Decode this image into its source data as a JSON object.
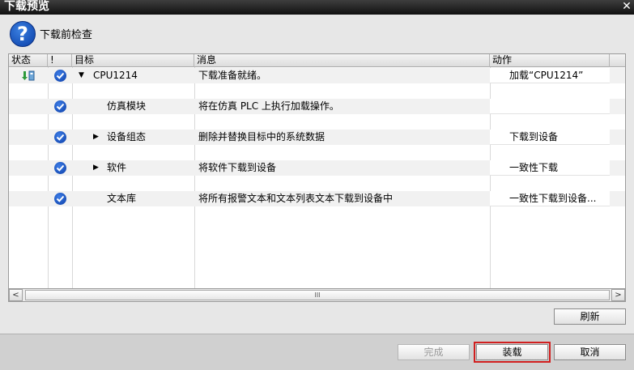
{
  "window": {
    "title": "下载预览",
    "close_glyph": "✕"
  },
  "header": {
    "text": "下载前检查"
  },
  "table": {
    "columns": [
      "状态",
      "!",
      "目标",
      "消息",
      "动作"
    ],
    "rows": [
      {
        "status_icon": "download-icon",
        "checked": true,
        "expander": "▼",
        "target": "CPU1214",
        "message": "下载准备就绪。",
        "action": "加载“CPU1214”"
      },
      {
        "checked": false,
        "expander": "",
        "target": "",
        "message": "",
        "action": ""
      },
      {
        "checked": true,
        "expander": "",
        "target": "仿真模块",
        "message": "将在仿真 PLC 上执行加载操作。",
        "action": ""
      },
      {
        "checked": false,
        "expander": "",
        "target": "",
        "message": "",
        "action": ""
      },
      {
        "checked": true,
        "expander": "▶",
        "target": "设备组态",
        "message": "删除并替换目标中的系统数据",
        "action": "下载到设备"
      },
      {
        "checked": false,
        "expander": "",
        "target": "",
        "message": "",
        "action": ""
      },
      {
        "checked": true,
        "expander": "▶",
        "target": "软件",
        "message": "将软件下载到设备",
        "action": "一致性下载"
      },
      {
        "checked": false,
        "expander": "",
        "target": "",
        "message": "",
        "action": ""
      },
      {
        "checked": true,
        "expander": "",
        "target": "文本库",
        "message": "将所有报警文本和文本列表文本下载到设备中",
        "action": "一致性下载到设备..."
      }
    ]
  },
  "scrollbar": {
    "left": "<",
    "right": ">",
    "grip": "III"
  },
  "buttons": {
    "refresh": "刷新",
    "finish": "完成",
    "load": "装载",
    "cancel": "取消"
  },
  "colors": {
    "highlight": "#d11f1f",
    "check_blue": "#0b3ea8"
  }
}
